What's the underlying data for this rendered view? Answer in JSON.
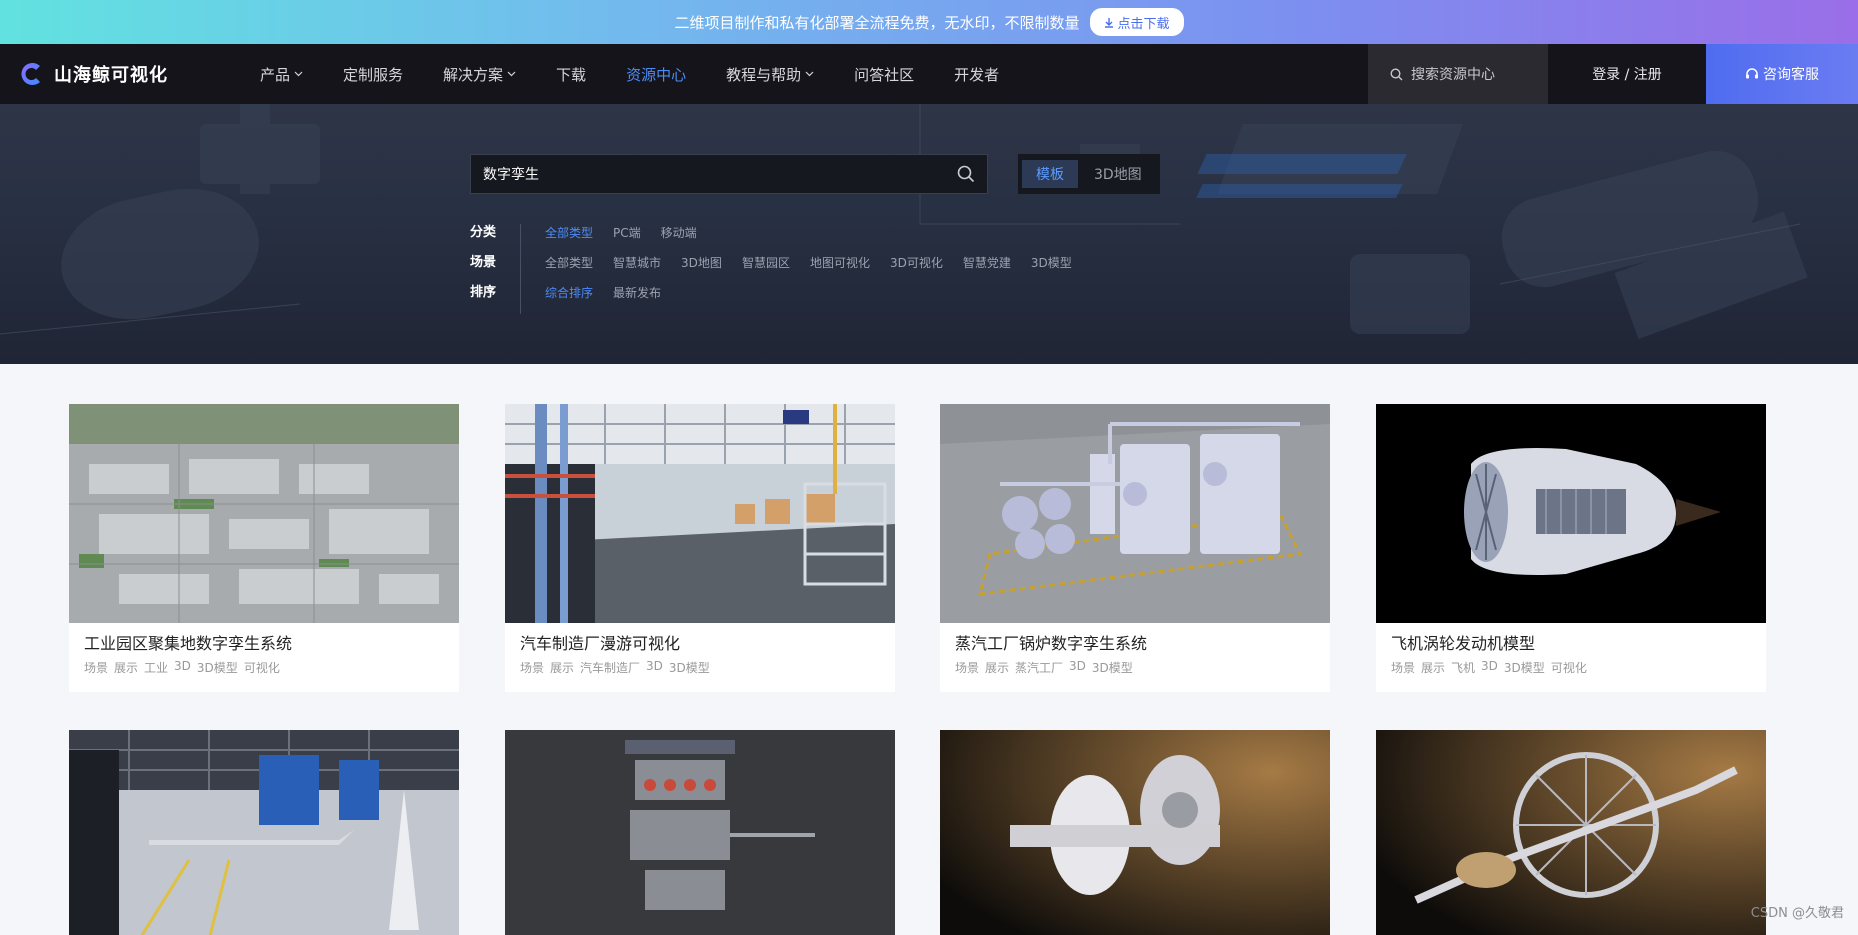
{
  "promo": {
    "text": "二维项目制作和私有化部署全流程免费，无水印，不限制数量",
    "button": "点击下载"
  },
  "nav": {
    "logo_text": "山海鲸可视化",
    "menu": [
      {
        "label": "产品",
        "dropdown": true
      },
      {
        "label": "定制服务",
        "dropdown": false
      },
      {
        "label": "解决方案",
        "dropdown": true
      },
      {
        "label": "下载",
        "dropdown": false
      },
      {
        "label": "资源中心",
        "dropdown": false,
        "active": true
      },
      {
        "label": "教程与帮助",
        "dropdown": true
      },
      {
        "label": "问答社区",
        "dropdown": false
      },
      {
        "label": "开发者",
        "dropdown": false
      }
    ],
    "search_placeholder": "搜索资源中心",
    "login": "登录 / 注册",
    "consult": "咨询客服"
  },
  "hero": {
    "search_value": "数字孪生",
    "switch": [
      "模板",
      "3D地图"
    ],
    "filters": {
      "labels": [
        "分类",
        "场景",
        "排序"
      ],
      "category": [
        "全部类型",
        "PC端",
        "移动端"
      ],
      "scene": [
        "全部类型",
        "智慧城市",
        "3D地图",
        "智慧园区",
        "地图可视化",
        "3D可视化",
        "智慧党建",
        "3D模型"
      ],
      "sort": [
        "综合排序",
        "最新发布"
      ]
    }
  },
  "cards": [
    {
      "title": "工业园区聚集地数字孪生系统",
      "tags": [
        "场景",
        "展示",
        "工业",
        "3D",
        "3D模型",
        "可视化"
      ]
    },
    {
      "title": "汽车制造厂漫游可视化",
      "tags": [
        "场景",
        "展示",
        "汽车制造厂",
        "3D",
        "3D模型"
      ]
    },
    {
      "title": "蒸汽工厂锅炉数字孪生系统",
      "tags": [
        "场景",
        "展示",
        "蒸汽工厂",
        "3D",
        "3D模型"
      ]
    },
    {
      "title": "飞机涡轮发动机模型",
      "tags": [
        "场景",
        "展示",
        "飞机",
        "3D",
        "3D模型",
        "可视化"
      ]
    }
  ],
  "watermark": "CSDN @久敬君",
  "colors": {
    "accent": "#4d8cf5",
    "nav_bg": "#15141a",
    "consult_bg": "#4f6cf0"
  }
}
